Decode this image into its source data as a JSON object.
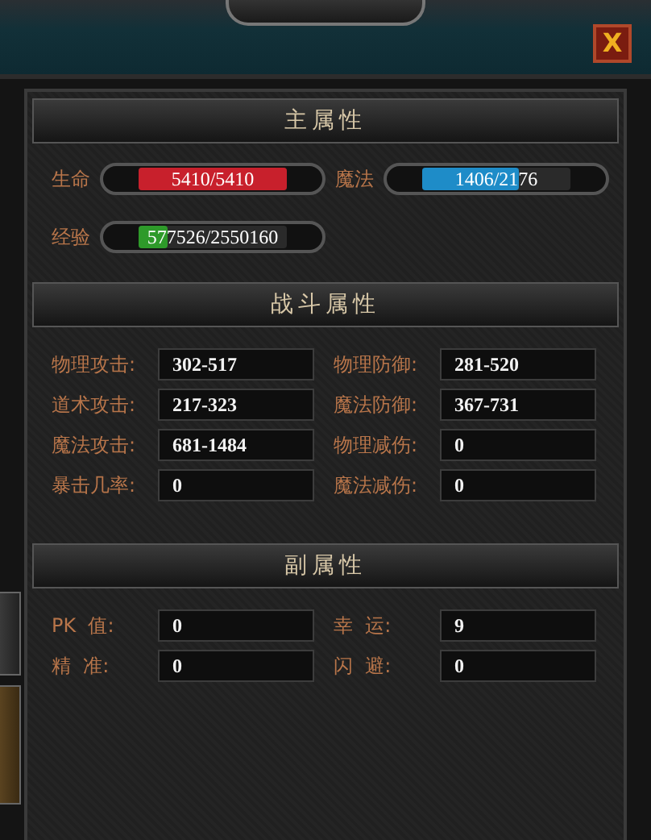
{
  "close_button": {
    "label": "X"
  },
  "side_tabs": [
    {
      "selected": false
    },
    {
      "selected": true
    }
  ],
  "sections": [
    {
      "title": "主属性",
      "kind": "bars",
      "rows": [
        [
          {
            "label": "生命",
            "value": "5410/5410",
            "level": 1.0,
            "color": "#c8202c"
          },
          {
            "label": "魔法",
            "value": "1406/2176",
            "level": 0.65,
            "color": "#1e8cc8"
          }
        ],
        [
          {
            "label": "经验",
            "value": "577526/2550160",
            "level": 0.2,
            "color": "#2e9a2a"
          }
        ]
      ]
    },
    {
      "title": "战斗属性",
      "kind": "fields",
      "rows": [
        [
          {
            "label": "物理攻击:",
            "value": "302-517"
          },
          {
            "label": "物理防御:",
            "value": "281-520"
          }
        ],
        [
          {
            "label": "道术攻击:",
            "value": "217-323"
          },
          {
            "label": "魔法防御:",
            "value": "367-731"
          }
        ],
        [
          {
            "label": "魔法攻击:",
            "value": "681-1484"
          },
          {
            "label": "物理减伤:",
            "value": "0"
          }
        ],
        [
          {
            "label": "暴击几率:",
            "value": "0"
          },
          {
            "label": "魔法减伤:",
            "value": "0"
          }
        ]
      ]
    },
    {
      "title": "副属性",
      "kind": "fields",
      "rows": [
        [
          {
            "label": "PK  值:",
            "value": "0"
          },
          {
            "label": "幸  运:",
            "value": "9"
          }
        ],
        [
          {
            "label": "精  准:",
            "value": "0"
          },
          {
            "label": "闪  避:",
            "value": "0"
          }
        ]
      ]
    }
  ]
}
